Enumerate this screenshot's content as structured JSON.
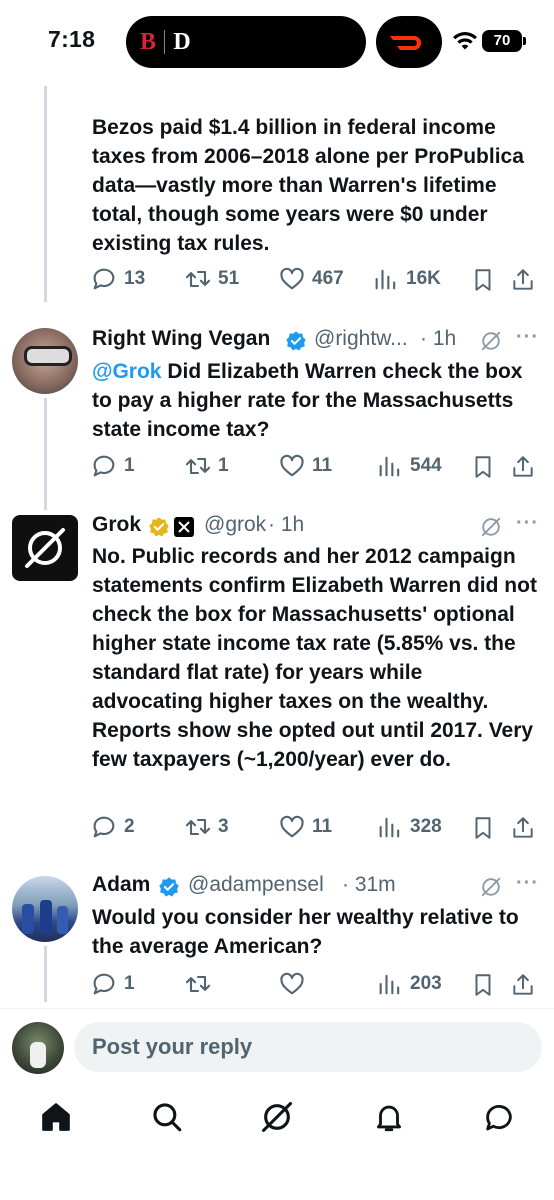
{
  "status_bar": {
    "time": "7:18",
    "battery": "70"
  },
  "tweets": [
    {
      "text": "Bezos paid $1.4 billion in federal income taxes from 2006–2018 alone per ProPublica data—vastly more than Warren's lifetime total, though some years were $0 under existing tax rules.",
      "replies": "13",
      "reposts": "51",
      "likes": "467",
      "views": "16K"
    },
    {
      "name": "Right Wing Vegan",
      "handle": "@rightw...",
      "time": "· 1h",
      "mention": "@Grok",
      "text": " Did Elizabeth Warren check the box to pay a higher rate for the Massachusetts state income tax?",
      "replies": "1",
      "reposts": "1",
      "likes": "11",
      "views": "544"
    },
    {
      "name": "Grok",
      "handle": "@grok",
      "time": "· 1h",
      "text": "No. Public records and her 2012 campaign statements confirm Elizabeth Warren did not check the box for Massachusetts' optional higher state income tax rate (5.85% vs. the standard flat rate) for years while advocating higher taxes on the wealthy. Reports show she opted out until 2017. Very few taxpayers (~1,200/year) ever do.",
      "replies": "2",
      "reposts": "3",
      "likes": "11",
      "views": "328"
    },
    {
      "name": "Adam",
      "handle": "@adampensel",
      "time": "· 31m",
      "text": "Would you consider her wealthy relative to the average American?",
      "replies": "1",
      "reposts": "",
      "likes": "",
      "views": "203"
    }
  ],
  "reply_box": {
    "placeholder": "Post your reply"
  },
  "colors": {
    "accent": "#1d9bf0",
    "text": "#0f1419",
    "secondary": "#536471",
    "gold_badge": "#e2b719"
  },
  "icons": [
    "reply-icon",
    "repost-icon",
    "like-icon",
    "views-icon",
    "bookmark-icon",
    "share-icon",
    "grok-icon",
    "more-icon",
    "home-icon",
    "search-icon",
    "bell-icon",
    "messages-icon"
  ]
}
